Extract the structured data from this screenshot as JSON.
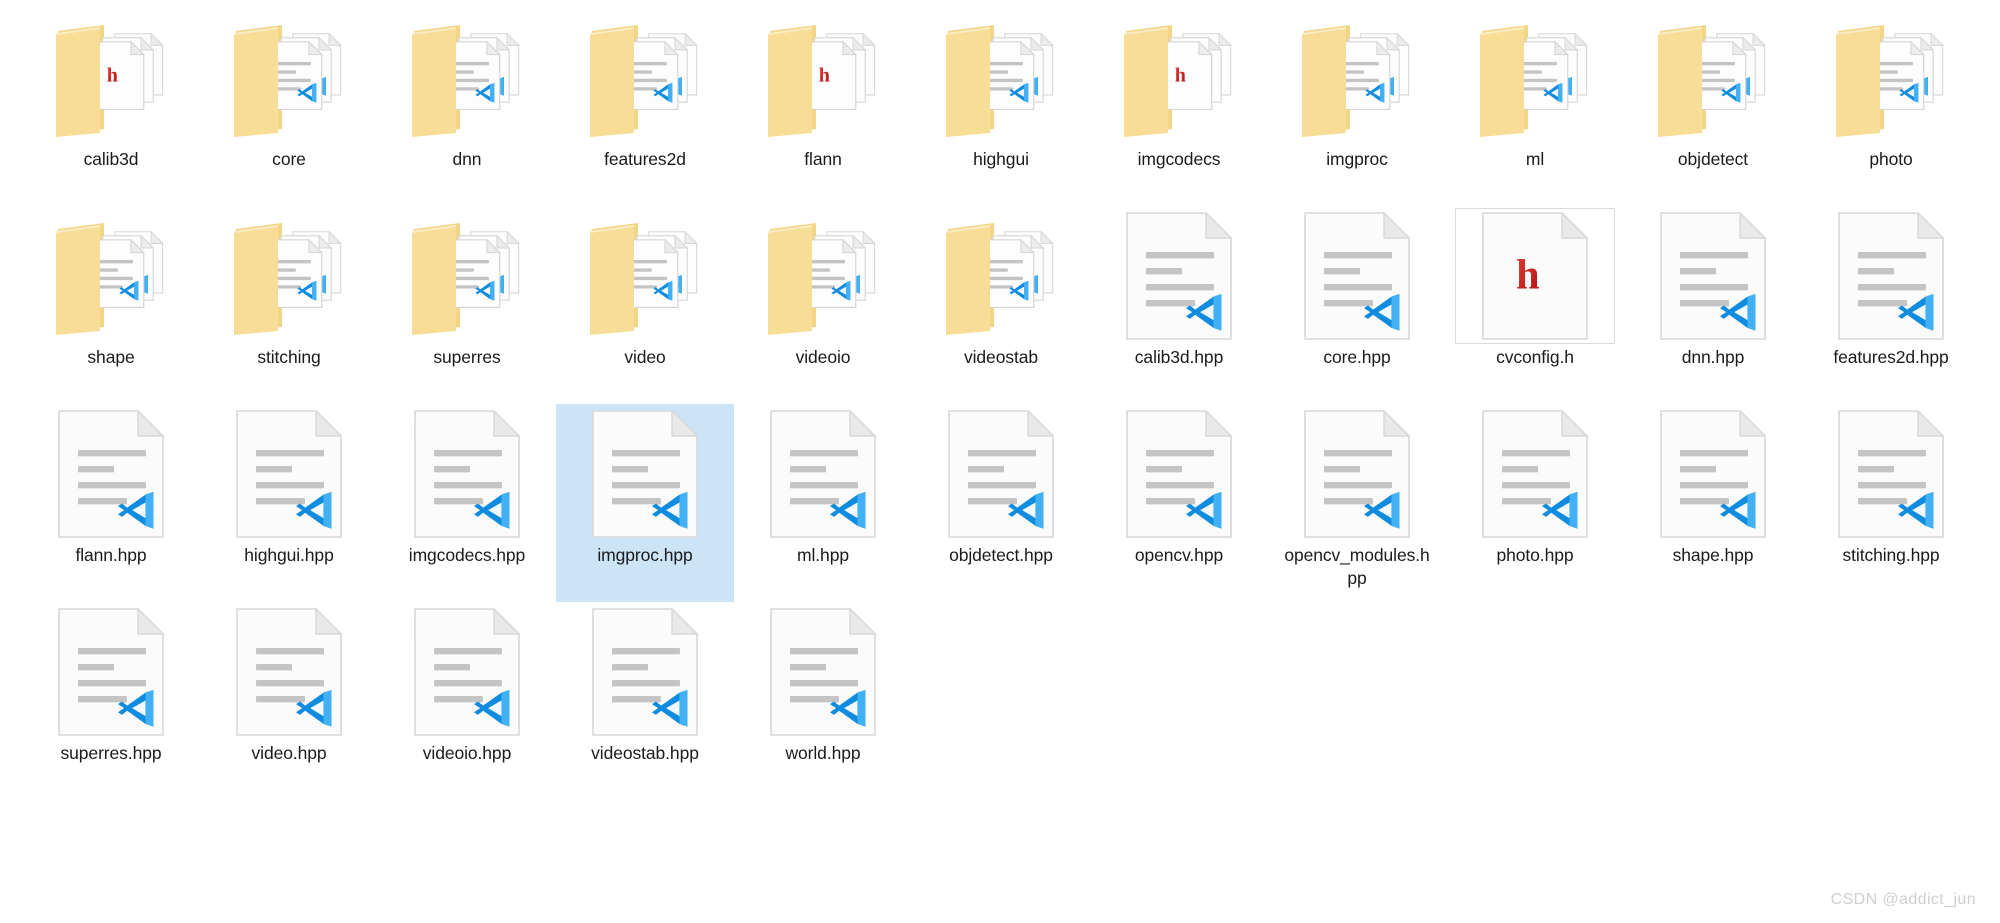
{
  "window": {
    "view": "file-explorer-icon-grid",
    "background_color": "#ffffff",
    "selection_color": "#cce4f7"
  },
  "colors": {
    "folder_front": "#f7dd96",
    "folder_back": "#f2d587",
    "paper": "#fbfbfb",
    "paper_border": "#d8d8d8",
    "text_line": "#c4c4c4",
    "vscode_dark": "#0f8ce0",
    "vscode_light": "#42b0f5",
    "h_red_dark": "#b01317",
    "h_red_light": "#e03a32",
    "label_text": "#1b1b1b",
    "focus_border": "#dcdcdc",
    "watermark": "#cfcfcf"
  },
  "watermark": {
    "text": "CSDN @addict_jun"
  },
  "items": [
    {
      "label": "calib3d",
      "type": "folder",
      "content": "h",
      "selected": false,
      "focus": false
    },
    {
      "label": "core",
      "type": "folder",
      "content": "lines",
      "selected": false,
      "focus": false
    },
    {
      "label": "dnn",
      "type": "folder",
      "content": "lines",
      "selected": false,
      "focus": false
    },
    {
      "label": "features2d",
      "type": "folder",
      "content": "lines",
      "selected": false,
      "focus": false
    },
    {
      "label": "flann",
      "type": "folder",
      "content": "h",
      "selected": false,
      "focus": false
    },
    {
      "label": "highgui",
      "type": "folder",
      "content": "lines",
      "selected": false,
      "focus": false
    },
    {
      "label": "imgcodecs",
      "type": "folder",
      "content": "h",
      "selected": false,
      "focus": false
    },
    {
      "label": "imgproc",
      "type": "folder",
      "content": "lines",
      "selected": false,
      "focus": false
    },
    {
      "label": "ml",
      "type": "folder",
      "content": "lines",
      "selected": false,
      "focus": false
    },
    {
      "label": "objdetect",
      "type": "folder",
      "content": "lines",
      "selected": false,
      "focus": false
    },
    {
      "label": "photo",
      "type": "folder",
      "content": "lines",
      "selected": false,
      "focus": false
    },
    {
      "label": "shape",
      "type": "folder",
      "content": "lines",
      "selected": false,
      "focus": false
    },
    {
      "label": "stitching",
      "type": "folder",
      "content": "lines",
      "selected": false,
      "focus": false
    },
    {
      "label": "superres",
      "type": "folder",
      "content": "lines",
      "selected": false,
      "focus": false
    },
    {
      "label": "video",
      "type": "folder",
      "content": "lines",
      "selected": false,
      "focus": false
    },
    {
      "label": "videoio",
      "type": "folder",
      "content": "lines",
      "selected": false,
      "focus": false
    },
    {
      "label": "videostab",
      "type": "folder",
      "content": "lines",
      "selected": false,
      "focus": false
    },
    {
      "label": "calib3d.hpp",
      "type": "file",
      "content": "vscode",
      "selected": false,
      "focus": false
    },
    {
      "label": "core.hpp",
      "type": "file",
      "content": "vscode",
      "selected": false,
      "focus": false
    },
    {
      "label": "cvconfig.h",
      "type": "file",
      "content": "h",
      "selected": false,
      "focus": true
    },
    {
      "label": "dnn.hpp",
      "type": "file",
      "content": "vscode",
      "selected": false,
      "focus": false
    },
    {
      "label": "features2d.hpp",
      "type": "file",
      "content": "vscode",
      "selected": false,
      "focus": false
    },
    {
      "label": "flann.hpp",
      "type": "file",
      "content": "vscode",
      "selected": false,
      "focus": false
    },
    {
      "label": "highgui.hpp",
      "type": "file",
      "content": "vscode",
      "selected": false,
      "focus": false
    },
    {
      "label": "imgcodecs.hpp",
      "type": "file",
      "content": "vscode",
      "selected": false,
      "focus": false
    },
    {
      "label": "imgproc.hpp",
      "type": "file",
      "content": "vscode",
      "selected": true,
      "focus": false
    },
    {
      "label": "ml.hpp",
      "type": "file",
      "content": "vscode",
      "selected": false,
      "focus": false
    },
    {
      "label": "objdetect.hpp",
      "type": "file",
      "content": "vscode",
      "selected": false,
      "focus": false
    },
    {
      "label": "opencv.hpp",
      "type": "file",
      "content": "vscode",
      "selected": false,
      "focus": false
    },
    {
      "label": "opencv_modules.hpp",
      "type": "file",
      "content": "vscode",
      "selected": false,
      "focus": false
    },
    {
      "label": "photo.hpp",
      "type": "file",
      "content": "vscode",
      "selected": false,
      "focus": false
    },
    {
      "label": "shape.hpp",
      "type": "file",
      "content": "vscode",
      "selected": false,
      "focus": false
    },
    {
      "label": "stitching.hpp",
      "type": "file",
      "content": "vscode",
      "selected": false,
      "focus": false
    },
    {
      "label": "superres.hpp",
      "type": "file",
      "content": "vscode",
      "selected": false,
      "focus": false
    },
    {
      "label": "video.hpp",
      "type": "file",
      "content": "vscode",
      "selected": false,
      "focus": false
    },
    {
      "label": "videoio.hpp",
      "type": "file",
      "content": "vscode",
      "selected": false,
      "focus": false
    },
    {
      "label": "videostab.hpp",
      "type": "file",
      "content": "vscode",
      "selected": false,
      "focus": false
    },
    {
      "label": "world.hpp",
      "type": "file",
      "content": "vscode",
      "selected": false,
      "focus": false
    }
  ]
}
